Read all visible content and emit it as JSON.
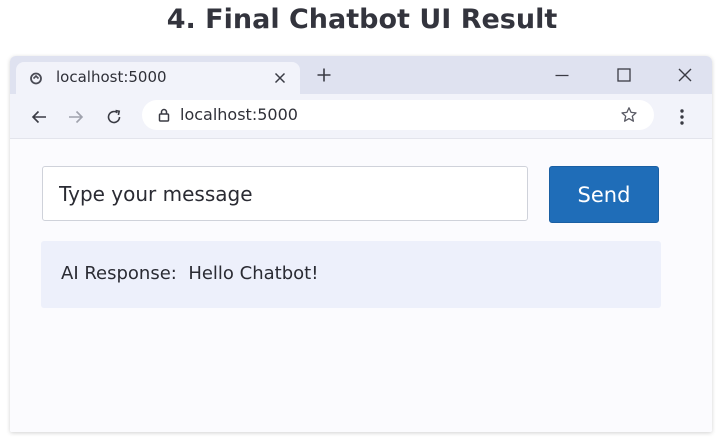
{
  "slide": {
    "title": "4. Final Chatbot UI Result"
  },
  "browser": {
    "tab": {
      "title": "localhost:5000",
      "favicon": "reload-globe-icon",
      "close_icon": "close-icon"
    },
    "new_tab_icon": "plus-icon",
    "window_controls": [
      "minimize-icon",
      "maximize-icon",
      "close-icon"
    ],
    "nav_icons": [
      "back-arrow-icon",
      "forward-arrow-icon",
      "reload-icon"
    ],
    "address_bar": {
      "url": "localhost:5000",
      "lock_icon": "lock-icon",
      "bookmark_icon": "star-icon"
    },
    "menu_icon": "kebab-menu-icon"
  },
  "chat": {
    "input_placeholder": "Type your message",
    "input_value": "",
    "send_label": "Send",
    "response_label": "AI Response:",
    "response_text": "Hello Chatbot!"
  },
  "colors": {
    "send_button": "#1f6db8",
    "response_background": "#edf0fb",
    "tabbar_background": "#dfe2f0",
    "toolbar_background": "#f2f3fa"
  }
}
